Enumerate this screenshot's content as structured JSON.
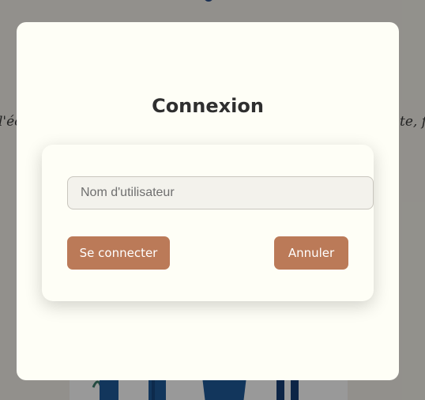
{
  "background": {
    "text_left": "l'éc",
    "text_right": "te, fi"
  },
  "login_modal": {
    "title": "Connexion",
    "username_placeholder": "Nom d'utilisateur",
    "username_value": "",
    "login_button": "Se connecter",
    "cancel_button": "Annuler"
  },
  "colors": {
    "button": "#bb7a58",
    "modal_background": "#fefef6",
    "overlay": "rgba(0,0,0,0.40)"
  }
}
